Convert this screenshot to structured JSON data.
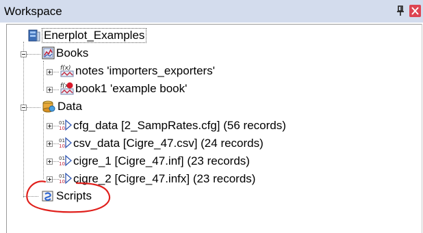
{
  "window": {
    "title": "Workspace",
    "pin_icon": "pin-icon",
    "close_icon": "close-icon"
  },
  "tree": {
    "root": {
      "label": "Enerplot_Examples",
      "icon": "project-icon"
    },
    "books": {
      "label": "Books",
      "icon": "books-icon",
      "items": [
        {
          "label": "notes 'importers_exporters'",
          "icon": "function-book-icon"
        },
        {
          "label": "book1 'example book'",
          "icon": "function-book-active-icon"
        }
      ]
    },
    "data": {
      "label": "Data",
      "icon": "data-icon",
      "items": [
        {
          "label": "cfg_data [2_SampRates.cfg] (56 records)",
          "icon": "datafile-icon"
        },
        {
          "label": "csv_data [Cigre_47.csv] (24 records)",
          "icon": "datafile-icon"
        },
        {
          "label": "cigre_1 [Cigre_47.inf] (23 records)",
          "icon": "datafile-icon"
        },
        {
          "label": "cigre_2 [Cigre_47.infx] (23 records)",
          "icon": "datafile-icon"
        }
      ]
    },
    "scripts": {
      "label": "Scripts",
      "icon": "scripts-icon"
    }
  },
  "annotation": {
    "type": "hand-drawn circle",
    "color": "#e0201c",
    "target": "Scripts"
  }
}
